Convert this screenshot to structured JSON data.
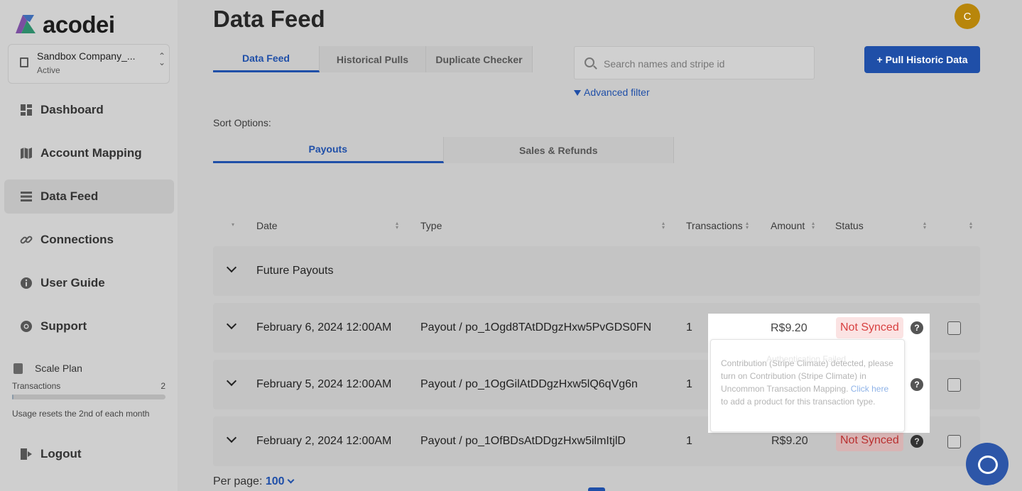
{
  "app": {
    "logo_text": "acodei",
    "avatar_initial": "C"
  },
  "sidebar": {
    "company": {
      "name": "Sandbox Company_...",
      "status": "Active"
    },
    "items": [
      {
        "label": "Dashboard",
        "icon": "dashboard-icon"
      },
      {
        "label": "Account Mapping",
        "icon": "map-icon"
      },
      {
        "label": "Data Feed",
        "icon": "list-icon",
        "active": true
      },
      {
        "label": "Connections",
        "icon": "link-icon"
      },
      {
        "label": "User Guide",
        "icon": "info-icon"
      },
      {
        "label": "Support",
        "icon": "lifebuoy-icon"
      }
    ],
    "plan": {
      "name": "Scale Plan",
      "transactions_label": "Transactions",
      "transactions_count": "2",
      "usage_fraction": 0.01,
      "reset_text": "Usage resets the 2nd of each month"
    },
    "logout_label": "Logout"
  },
  "main": {
    "title": "Data Feed",
    "tabs": [
      "Data Feed",
      "Historical Pulls",
      "Duplicate Checker"
    ],
    "search_placeholder": "Search names and stripe id",
    "advanced_filter": "Advanced filter",
    "pull_button": "+ Pull Historic Data",
    "sort_label": "Sort Options:",
    "sort_tabs": [
      "Payouts",
      "Sales & Refunds"
    ],
    "columns": [
      "Date",
      "Type",
      "Transactions",
      "Amount",
      "Status"
    ],
    "group_label": "Future Payouts",
    "rows": [
      {
        "date": "February 6, 2024 12:00AM",
        "type": "Payout / po_1Ogd8TAtDDgzHxw5PvGDS0FN",
        "transactions": "1",
        "amount": "R$9.20",
        "status": "Not Synced"
      },
      {
        "date": "February 5, 2024 12:00AM",
        "type": "Payout / po_1OgGilAtDDgzHxw5lQ6qVg6n",
        "transactions": "1",
        "amount": "",
        "status": ""
      },
      {
        "date": "February 2, 2024 12:00AM",
        "type": "Payout / po_1OfBDsAtDDgzHxw5ilmItjlD",
        "transactions": "1",
        "amount": "R$9.20",
        "status": "Not Synced"
      }
    ],
    "tooltip": {
      "ghost_text": "Authentication Failed",
      "text_before": "Contribution (Stripe Climate) detected, please turn on Contribution (Stripe Climate) in Uncommon Transaction Mapping. ",
      "link_text": "Click here",
      "text_after": " to add a product for this transaction type."
    },
    "per_page_label": "Per page:",
    "per_page_value": "100"
  },
  "colors": {
    "accent": "#1f4fa8",
    "avatar": "#b8860b",
    "error": "#d84040"
  }
}
